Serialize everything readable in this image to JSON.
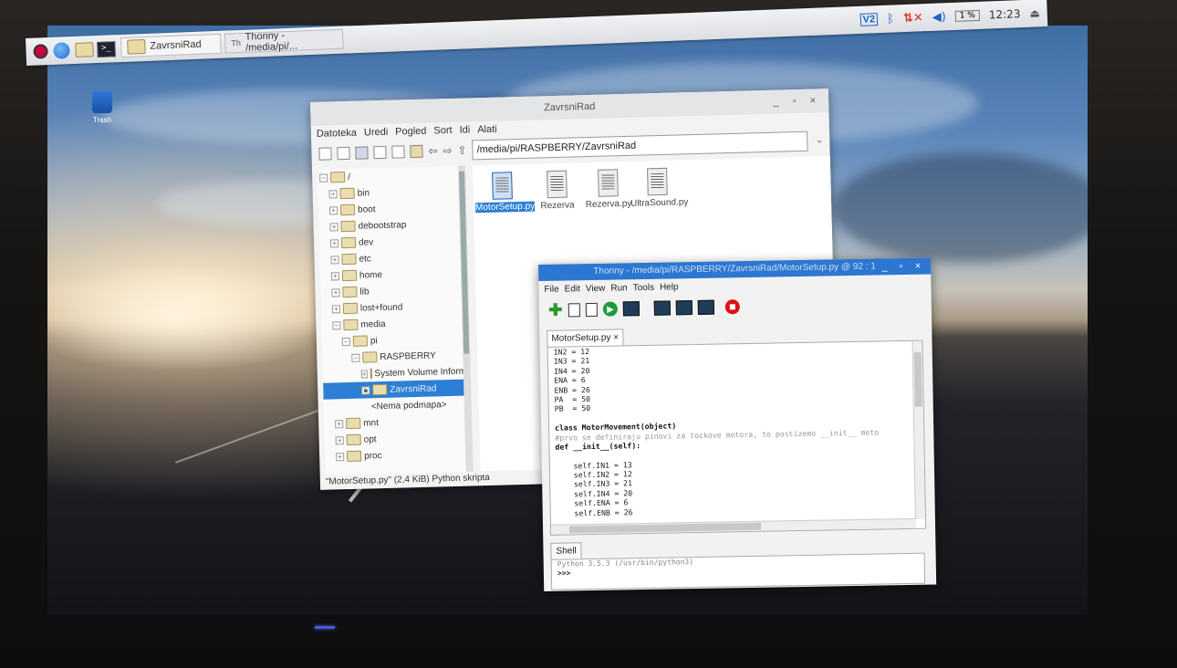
{
  "panel": {
    "tasks": [
      {
        "label": "ZavrsniRad"
      },
      {
        "label": "Thonny - /media/pi/..."
      }
    ],
    "tray": {
      "vnc": "V2",
      "cpu": "1 %",
      "clock": "12:23"
    }
  },
  "desktop": {
    "trash_label": "Trash"
  },
  "file_manager": {
    "title": "ZavrsniRad",
    "menu": [
      "Datoteka",
      "Uredi",
      "Pogled",
      "Sort",
      "Idi",
      "Alati"
    ],
    "path": "/media/pi/RASPBERRY/ZavrsniRad",
    "tree": [
      {
        "label": "/",
        "level": 0,
        "exp": "−"
      },
      {
        "label": "bin",
        "level": 1,
        "exp": "+"
      },
      {
        "label": "boot",
        "level": 1,
        "exp": "+"
      },
      {
        "label": "debootstrap",
        "level": 1,
        "exp": "+"
      },
      {
        "label": "dev",
        "level": 1,
        "exp": "+"
      },
      {
        "label": "etc",
        "level": 1,
        "exp": "+"
      },
      {
        "label": "home",
        "level": 1,
        "exp": "+"
      },
      {
        "label": "lib",
        "level": 1,
        "exp": "+"
      },
      {
        "label": "lost+found",
        "level": 1,
        "exp": "+"
      },
      {
        "label": "media",
        "level": 1,
        "exp": "−"
      },
      {
        "label": "pi",
        "level": 2,
        "exp": "−"
      },
      {
        "label": "RASPBERRY",
        "level": 3,
        "exp": "−"
      },
      {
        "label": "System Volume Informa",
        "level": 4,
        "exp": "+"
      },
      {
        "label": "ZavrsniRad",
        "level": 4,
        "exp": "■",
        "selected": true
      },
      {
        "label": "<Nema podmapa>",
        "level": 5,
        "exp": "",
        "nofolder": true
      },
      {
        "label": "mnt",
        "level": 1,
        "exp": "+"
      },
      {
        "label": "opt",
        "level": 1,
        "exp": "+"
      },
      {
        "label": "proc",
        "level": 1,
        "exp": "+"
      }
    ],
    "files": [
      {
        "name": "MotorSetup.py",
        "selected": true
      },
      {
        "name": "Rezerva"
      },
      {
        "name": "Rezerva.py"
      },
      {
        "name": "UltraSound.py"
      }
    ],
    "status": "\"MotorSetup.py\" (2,4 KiB) Python skripta"
  },
  "thonny": {
    "title": "Thonny - /media/pi/RASPBERRY/ZavrsniRad/MotorSetup.py @ 92 : 1",
    "menu": [
      "File",
      "Edit",
      "View",
      "Run",
      "Tools",
      "Help"
    ],
    "tab": "MotorSetup.py ×",
    "code": [
      {
        "t": "IN2 = 12"
      },
      {
        "t": "IN3 = 21"
      },
      {
        "t": "IN4 = 20"
      },
      {
        "t": "ENA = 6"
      },
      {
        "t": "ENB = 26"
      },
      {
        "t": "PA  = 50"
      },
      {
        "t": "PB  = 50"
      },
      {
        "t": ""
      },
      {
        "t": "class MotorMovement(object)",
        "k": "kw"
      },
      {
        "t": "#prvo se definiraju pinovi za tockove motora, to postizemo __init__ meto",
        "k": "cm"
      },
      {
        "t": "def __init__(self):",
        "k": "kw"
      },
      {
        "t": ""
      },
      {
        "t": "    self.IN1 = 13"
      },
      {
        "t": "    self.IN2 = 12"
      },
      {
        "t": "    self.IN3 = 21"
      },
      {
        "t": "    self.IN4 = 20"
      },
      {
        "t": "    self.ENA = 6"
      },
      {
        "t": "    self.ENB = 26"
      }
    ],
    "shell_tab": "Shell",
    "shell_version": "Python 3.5.3 (/usr/bin/python3)",
    "shell_prompt": ">>>"
  }
}
